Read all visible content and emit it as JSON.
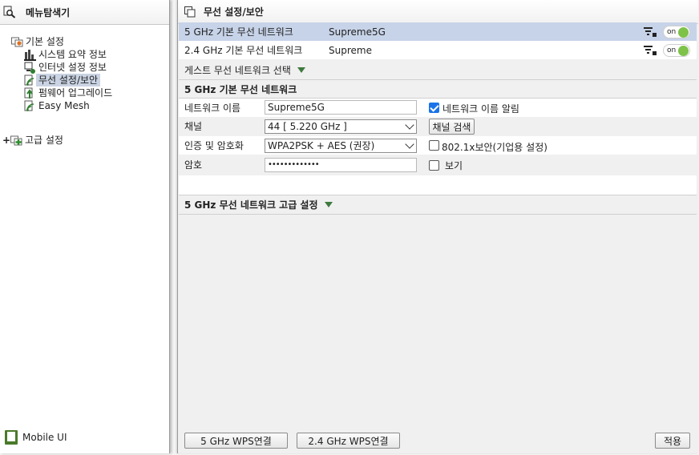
{
  "left_panel": {
    "title": "메뉴탐색기",
    "tree": {
      "basic": "기본 설정",
      "items": [
        "시스템 요약 정보",
        "인터넷 설정 정보",
        "무선 설정/보안",
        "펌웨어 업그레이드",
        "Easy Mesh"
      ],
      "selected_index": 2,
      "advanced": "고급 설정",
      "advanced_expander": "+"
    },
    "mobile_ui": "Mobile UI"
  },
  "right_panel": {
    "title": "무선 설정/보안",
    "networks": [
      {
        "name": "5 GHz 기본 무선 네트워크",
        "ssid": "Supreme5G",
        "toggle": "on",
        "selected": true
      },
      {
        "name": "2.4 GHz 기본 무선 네트워크",
        "ssid": "Supreme",
        "toggle": "on",
        "selected": false
      }
    ],
    "guest_label": "게스트 무선 네트워크 선택",
    "section_title": "5 GHz 기본 무선 네트워크",
    "form": {
      "network_name_label": "네트워크 이름",
      "network_name_value": "Supreme5G",
      "broadcast_label": "네트워크 이름 알림",
      "broadcast_checked": true,
      "channel_label": "채널",
      "channel_value": "44 [ 5.220 GHz ]",
      "channel_search_button": "채널 검색",
      "auth_label": "인증 및 암호화",
      "auth_value": "WPA2PSK + AES (권장)",
      "enterprise_label": "802.1x보안(기업용 설정)",
      "enterprise_checked": false,
      "password_label": "암호",
      "password_value": "•••••••••••••",
      "show_label": "보기",
      "show_checked": false
    },
    "advanced_title": "5 GHz 무선 네트워크 고급 설정",
    "footer": {
      "wps5": "5 GHz WPS연결",
      "wps24": "2.4 GHz WPS연결",
      "apply": "적용"
    }
  },
  "colors": {
    "selection": "#c7d3e8",
    "toggle_on": "#7ec24a",
    "expand_triangle": "#3e7a3e"
  }
}
